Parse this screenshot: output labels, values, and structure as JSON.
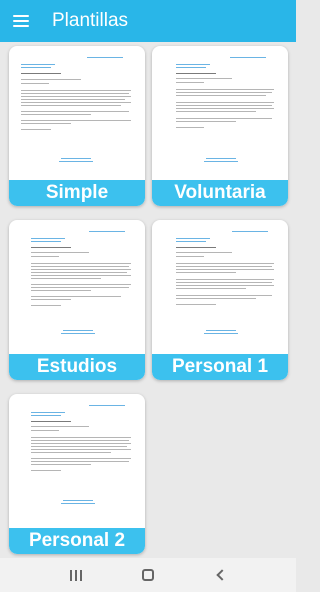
{
  "app": {
    "title": "Plantillas"
  },
  "templates": [
    {
      "label": "Simple"
    },
    {
      "label": "Voluntaria"
    },
    {
      "label": "Estudios"
    },
    {
      "label": "Personal 1"
    },
    {
      "label": "Personal 2"
    }
  ],
  "colors": {
    "appbar": "#29b6e8",
    "card_label": "#3cc1ee",
    "background": "#e9e9e9"
  },
  "icons": {
    "menu": "menu-icon",
    "recents": "recents-icon",
    "home": "home-icon",
    "back": "back-icon"
  }
}
